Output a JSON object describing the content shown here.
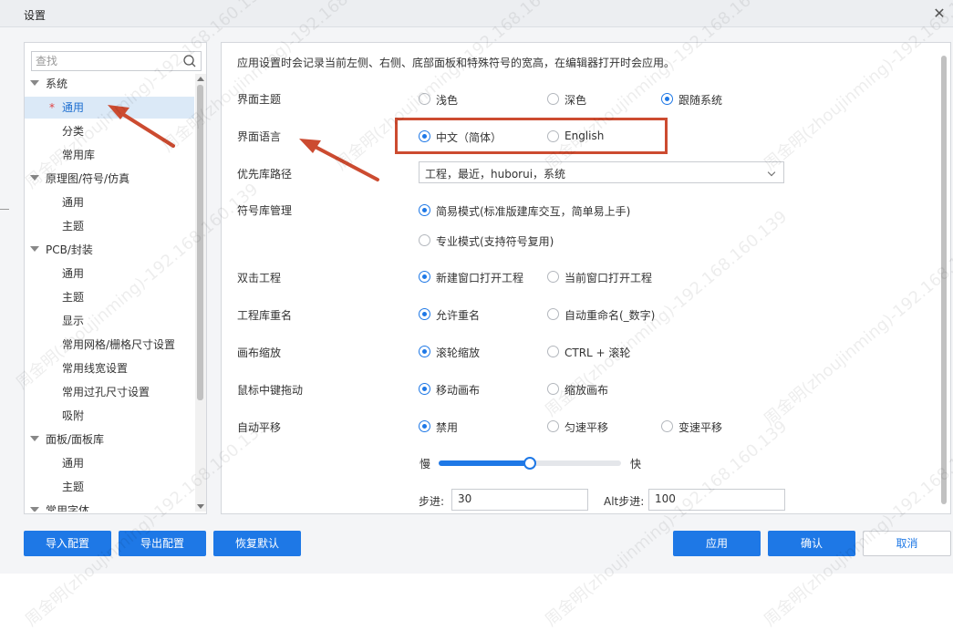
{
  "window": {
    "title": "设置",
    "close_glyph": "✕"
  },
  "tree": {
    "search_placeholder": "查找",
    "items": [
      {
        "label": "系统",
        "level": 0,
        "expanded": true
      },
      {
        "label": "通用",
        "level": 1,
        "selected": true,
        "modified_mark": "*"
      },
      {
        "label": "分类",
        "level": 1
      },
      {
        "label": "常用库",
        "level": 1
      },
      {
        "label": "原理图/符号/仿真",
        "level": 0,
        "expanded": true
      },
      {
        "label": "通用",
        "level": 1
      },
      {
        "label": "主题",
        "level": 1
      },
      {
        "label": "PCB/封装",
        "level": 0,
        "expanded": true
      },
      {
        "label": "通用",
        "level": 1
      },
      {
        "label": "主题",
        "level": 1
      },
      {
        "label": "显示",
        "level": 1
      },
      {
        "label": "常用网格/栅格尺寸设置",
        "level": 1
      },
      {
        "label": "常用线宽设置",
        "level": 1
      },
      {
        "label": "常用过孔尺寸设置",
        "level": 1
      },
      {
        "label": "吸附",
        "level": 1
      },
      {
        "label": "面板/面板库",
        "level": 0,
        "expanded": true
      },
      {
        "label": "通用",
        "level": 1
      },
      {
        "label": "主题",
        "level": 1
      },
      {
        "label": "常用字体",
        "level": 0,
        "expanded": true
      }
    ]
  },
  "settings": {
    "description": "应用设置时会记录当前左侧、右侧、底部面板和特殊符号的宽高，在编辑器打开时会应用。",
    "rows": {
      "theme": {
        "label": "界面主题",
        "options": [
          "浅色",
          "深色",
          "跟随系统"
        ],
        "selected": 2
      },
      "language": {
        "label": "界面语言",
        "options": [
          "中文（简体）",
          "English"
        ],
        "selected": 0
      },
      "lib_path": {
        "label": "优先库路径",
        "value": "工程，最近，huborui，系统"
      },
      "symbol_mgmt": {
        "label": "符号库管理",
        "options": [
          "简易模式(标准版建库交互，简单易上手)",
          "专业模式(支持符号复用)"
        ],
        "selected": 0
      },
      "dblclick": {
        "label": "双击工程",
        "options": [
          "新建窗口打开工程",
          "当前窗口打开工程"
        ],
        "selected": 0
      },
      "rename": {
        "label": "工程库重名",
        "options": [
          "允许重名",
          "自动重命名(_数字)"
        ],
        "selected": 0
      },
      "zoom": {
        "label": "画布缩放",
        "options": [
          "滚轮缩放",
          "CTRL + 滚轮"
        ],
        "selected": 0
      },
      "middle_drag": {
        "label": "鼠标中键拖动",
        "options": [
          "移动画布",
          "缩放画布"
        ],
        "selected": 0
      },
      "auto_pan": {
        "label": "自动平移",
        "options": [
          "禁用",
          "匀速平移",
          "变速平移"
        ],
        "selected": 0
      }
    },
    "speed": {
      "slow": "慢",
      "fast": "快",
      "value_fraction": 0.5
    },
    "step": {
      "label": "步进:",
      "value": "30"
    },
    "alt_step": {
      "label": "Alt步进:",
      "value": "100"
    }
  },
  "footer": {
    "import": "导入配置",
    "export": "导出配置",
    "reset": "恢复默认",
    "apply": "应用",
    "ok": "确认",
    "cancel": "取消"
  },
  "colors": {
    "accent": "#1e78e6",
    "annotation": "#cc4b30"
  },
  "watermark": "周金明(zhoujinming)-192.168.160.139"
}
